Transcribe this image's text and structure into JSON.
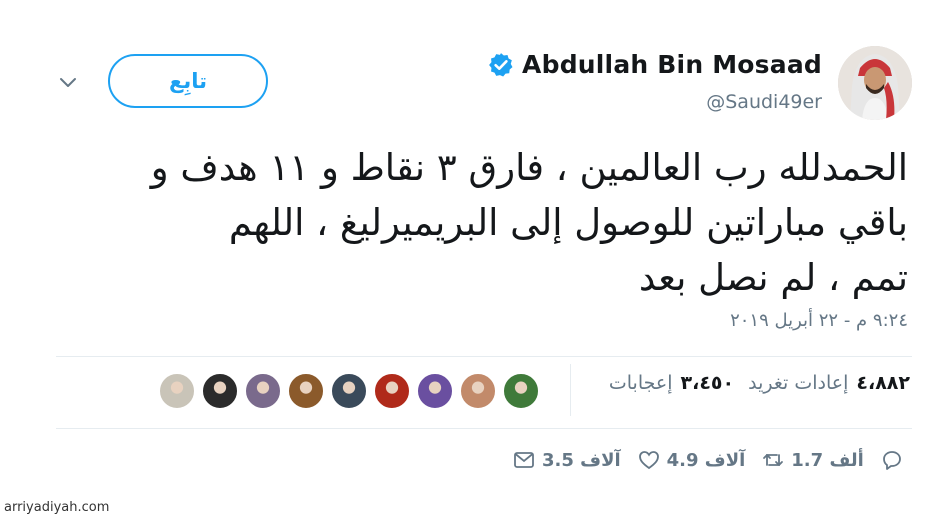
{
  "author": {
    "display_name": "Abdullah Bin Mosaad",
    "handle": "@Saudi49er",
    "verified": true
  },
  "follow_button": {
    "label": "تابِع"
  },
  "tweet": {
    "lines": [
      "الحمدلله رب العالمين ، فارق ٣ نقاط و ١١ هدف و",
      "باقي مباراتين للوصول إلى البريميرليغ ، اللهم",
      "تمم ، لم نصل بعد"
    ],
    "timestamp": "٩:٢٤ م - ٢٢ أبريل ٢٠١٩"
  },
  "stats": {
    "retweets_count": "٤،٨٨٢",
    "retweets_label": "إعادات تغريد",
    "likes_count": "٣،٤٥٠",
    "likes_label": "إعجابات"
  },
  "actions": {
    "reply_count": "1.7 ألف",
    "retweet_count": "4.9 آلاف",
    "like_count": "3.5 آلاف"
  },
  "likers": [
    {
      "color": "#c9c4b8"
    },
    {
      "color": "#2b2b2b"
    },
    {
      "color": "#7a6a8c"
    },
    {
      "color": "#8b5a2b"
    },
    {
      "color": "#3a4a5a"
    },
    {
      "color": "#b02a1a"
    },
    {
      "color": "#6a4fa0"
    },
    {
      "color": "#c28a6a"
    },
    {
      "color": "#3f7a3a"
    }
  ],
  "colors": {
    "accent": "#1da1f2",
    "muted": "#657786",
    "text": "#14171a"
  },
  "watermark": "arriyadiyah.com"
}
